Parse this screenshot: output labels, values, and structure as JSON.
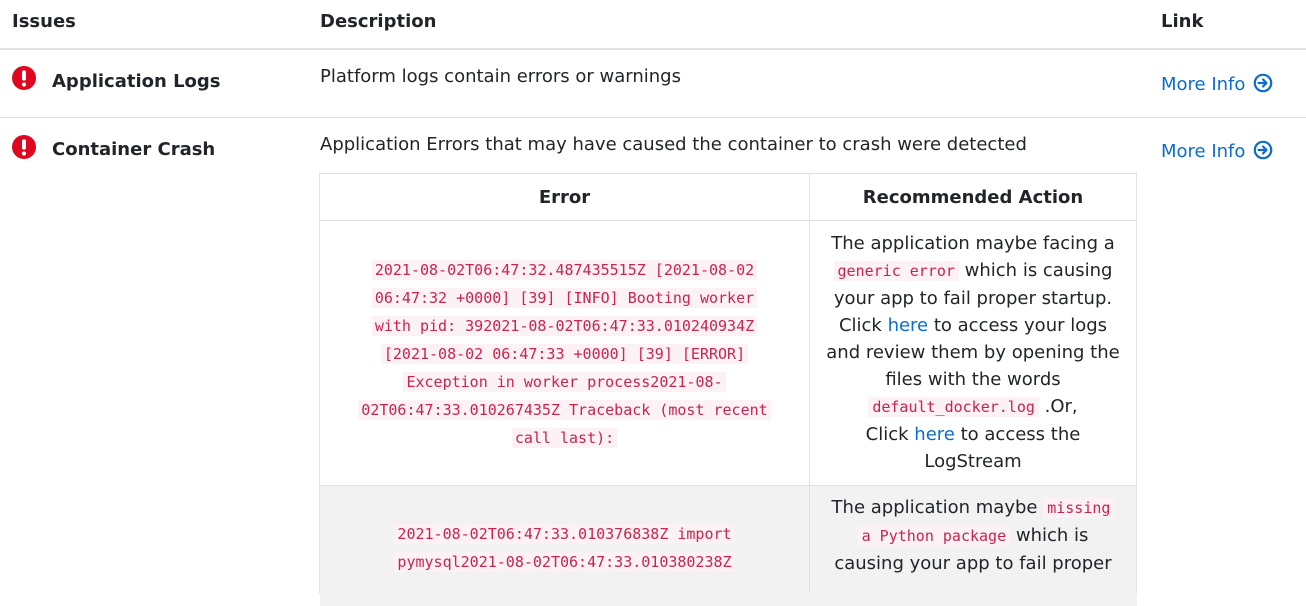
{
  "header": {
    "issues": "Issues",
    "description": "Description",
    "link": "Link"
  },
  "rows": [
    {
      "issue": "Application Logs",
      "description": "Platform logs contain errors or warnings",
      "link": "More Info"
    },
    {
      "issue": "Container Crash",
      "description": "Application Errors that may have caused the container to crash were detected",
      "link": "More Info",
      "table": {
        "headers": [
          "Error",
          "Recommended Action"
        ],
        "rows": [
          {
            "error_lines": [
              "2021-08-02T06:47:32.487435515Z [2021-08-02",
              "06:47:32 +0000] [39] [INFO] Booting worker",
              "with pid: 392021-08-02T06:47:33.010240934Z",
              "[2021-08-02 06:47:33 +0000] [39] [ERROR]",
              "Exception in worker process2021-08-",
              "02T06:47:33.010267435Z Traceback (most recent",
              "call last):"
            ],
            "action": {
              "l1": "The application maybe facing a",
              "code1": "generic error",
              "l2": "which is causing",
              "l3": "your app to fail proper startup.",
              "click": "Click",
              "here": "here",
              "l4": "to access your logs",
              "l5": "and review them by opening the",
              "l6": "files with the words",
              "code2": "default_docker.log",
              "l7": ".Or,",
              "click2": "Click",
              "here2": "here",
              "l8": "to access the",
              "l9": "LogStream"
            }
          },
          {
            "error_lines": [
              "2021-08-02T06:47:33.010376838Z import",
              "pymysql2021-08-02T06:47:33.010380238Z"
            ],
            "action": {
              "l1": "The application maybe",
              "code1a": "missing",
              "code1b": "a Python package",
              "l2": "which is",
              "l3": "causing your app to fail proper"
            }
          }
        ]
      }
    }
  ],
  "colors": {
    "error_red": "#e0061f",
    "link_blue": "#0b6ccf",
    "code_red": "#c7254e"
  },
  "icons": {
    "issue": "exclamation-circle-icon",
    "more_info": "arrow-circle-right-icon"
  }
}
